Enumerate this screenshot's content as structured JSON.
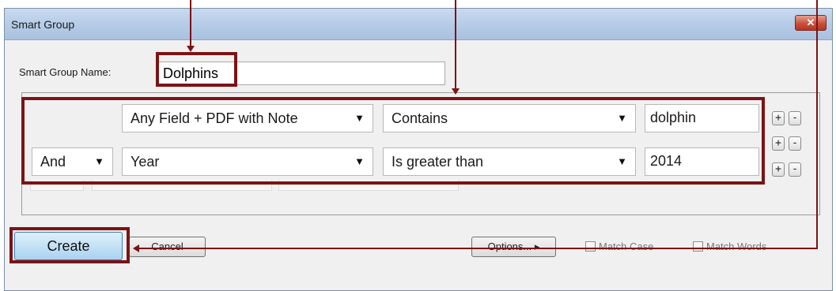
{
  "window": {
    "title": "Smart Group",
    "close_glyph": "✕"
  },
  "name": {
    "label": "Smart Group Name:",
    "value": "Dolphins"
  },
  "criteria": [
    {
      "connector": "",
      "field": "Any Field + PDF with Note",
      "operator": "Contains",
      "value": "dolphin"
    },
    {
      "connector": "And",
      "field": "Year",
      "operator": "Is greater than",
      "value": "2014"
    }
  ],
  "row_buttons": {
    "add": "+",
    "remove": "-"
  },
  "buttons": {
    "create": "Create",
    "cancel": "Cancel",
    "options": "Options... ▸"
  },
  "checkboxes": {
    "match_case": "Match Case",
    "match_words": "Match Words"
  },
  "annotation_color": "#7b1315"
}
